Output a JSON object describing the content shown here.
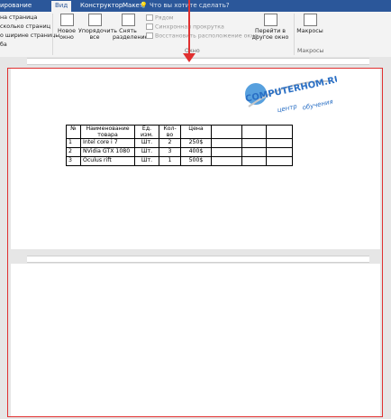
{
  "tabs": [
    {
      "label": "ирование",
      "active": false
    },
    {
      "label": "Вид",
      "active": true
    },
    {
      "label": "Конструктор",
      "active": false
    },
    {
      "label": "Макет",
      "active": false
    }
  ],
  "tell_me": "Что вы хотите сделать?",
  "ribbon": {
    "left_items": [
      "на страница",
      "сколько страниц",
      "о ширине страницы",
      "ба"
    ],
    "new_window": "Новое окно",
    "arrange_all": "Упорядочить все",
    "split": "Снять разделение",
    "side_by_side": "Рядом",
    "sync_scroll": "Синхронная прокрутка",
    "reset_position": "Восстановить расположение окна",
    "switch_window": "Перейти в другое окно",
    "macros": "Макросы",
    "window_group": "Окно",
    "macros_group": "Макросы"
  },
  "table": {
    "headers": [
      "№",
      "Наименование товара",
      "Ед. изм.",
      "Кол-во",
      "Цена",
      "",
      "",
      ""
    ],
    "rows": [
      [
        "1",
        "Intel core i 7",
        "Шт.",
        "2",
        "250$",
        "",
        "",
        ""
      ],
      [
        "2",
        "NVidia GTX 1080",
        "Шт.",
        "3",
        "400$",
        "",
        "",
        ""
      ],
      [
        "3",
        "Oculus rift",
        "Шт.",
        "1",
        "500$",
        "",
        "",
        ""
      ]
    ]
  },
  "logo": {
    "line1": "COMPUTERHOM.RU",
    "line2": "центр",
    "line3": "обучения"
  },
  "colors": {
    "accent": "#2b579a",
    "highlight": "#e03030"
  }
}
